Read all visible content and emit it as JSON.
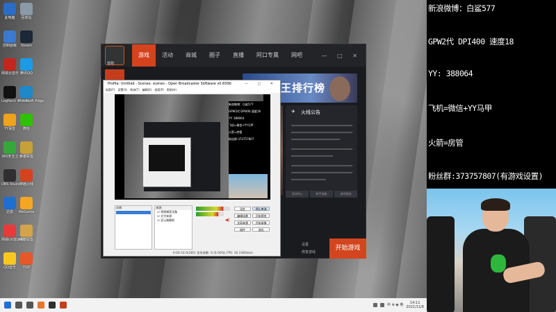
{
  "desktop": {
    "icons": [
      {
        "label": "此电脑",
        "color": "#2a6cc7"
      },
      {
        "label": "回收站",
        "color": "#8a9aa8"
      },
      {
        "label": "控制面板",
        "color": "#3a7ad0"
      },
      {
        "label": "Steam",
        "color": "#1b2838"
      },
      {
        "label": "网易云音乐",
        "color": "#c4261d"
      },
      {
        "label": "腾讯QQ",
        "color": "#1a9be8"
      },
      {
        "label": "Logitech G HUB",
        "color": "#111111"
      },
      {
        "label": "Microsoft Edge",
        "color": "#1e88c8"
      },
      {
        "label": "YY语音",
        "color": "#f0a21c"
      },
      {
        "label": "微信",
        "color": "#2dc100"
      },
      {
        "label": "360安全卫士",
        "color": "#36a83a"
      },
      {
        "label": "英雄联盟",
        "color": "#c8a03a"
      },
      {
        "label": "OBS Studio",
        "color": "#302e31"
      },
      {
        "label": "穿越火线",
        "color": "#d4431e"
      },
      {
        "label": "迅雷",
        "color": "#1f6fd1"
      },
      {
        "label": "WeGame",
        "color": "#f5a623"
      },
      {
        "label": "网易UU加速器",
        "color": "#e83a3a"
      },
      {
        "label": "英雄联盟",
        "color": "#d4a34a"
      },
      {
        "label": "QQ音乐",
        "color": "#f9c81e"
      },
      {
        "label": "TGP",
        "color": "#e5582a"
      }
    ]
  },
  "launcher": {
    "avatar_label": "苍刚",
    "tabs": [
      "游戏",
      "活动",
      "商城",
      "圈子",
      "直播",
      "阿口专属",
      "网吧"
    ],
    "active_tab": "游戏",
    "window_buttons": "— □ ✕",
    "banner_text": "王排行榜",
    "notice_title": "火线公告",
    "notice_buttons": [
      "活动中心",
      "新手指南",
      "游戏帮助"
    ],
    "links": [
      "设置",
      "修复游戏"
    ],
    "start_label": "开始游戏"
  },
  "obs": {
    "title": "Profile: Untitled - Scenes: scenes - Open Broadcaster Software v0.659b",
    "window_buttons": "— □ ✕",
    "menu": [
      "档案(F)",
      "设置(S)",
      "串流(T)",
      "编辑(E)",
      "档案(P)",
      "帮助(H)"
    ],
    "scenes_header": "场景：",
    "sources_header": "来源：",
    "sources": [
      "视频捕获设备",
      "文字来源",
      "显示器截取"
    ],
    "buttons": [
      {
        "label": "设定",
        "active": false
      },
      {
        "label": "停止串流",
        "active": true
      },
      {
        "label": "编辑场景",
        "active": false
      },
      {
        "label": "开始预览",
        "active": false
      },
      {
        "label": "全局来源",
        "active": false
      },
      {
        "label": "开始录像",
        "active": false
      },
      {
        "label": "插件",
        "active": false
      },
      {
        "label": "退出",
        "active": false
      }
    ],
    "status": "0:00:16   0(285)    丢失帧数: 0 (0.00%)     FPS: 30    2485kb/s",
    "preview_text": [
      "新浪微博：白鲨577",
      "GPW2代 DPI400 速度18",
      "YY: 388064",
      "飞机=微信+YY马甲",
      "火箭=房管",
      "粉丝群:373757807"
    ]
  },
  "taskbar": {
    "apps": [
      {
        "name": "windows-logo",
        "color": "#1e6fd9"
      },
      {
        "name": "search",
        "color": "#555555"
      },
      {
        "name": "task-view",
        "color": "#555555"
      },
      {
        "name": "wegame",
        "color": "#e8762a"
      },
      {
        "name": "obs",
        "color": "#302e31"
      },
      {
        "name": "crossfire",
        "color": "#c43e1e"
      }
    ],
    "tray_text": "中 ⊕ ◉ 英",
    "time": "14:11",
    "date": "2021/11/6"
  },
  "overlay": {
    "lines": [
      "新浪微博：白鲨577",
      "GPW2代 DPI400 速度18",
      "YY: 388064",
      "飞机=微信+YY马甲",
      "火箭=房管",
      "粉丝群:373757807(有游戏设置)"
    ]
  }
}
